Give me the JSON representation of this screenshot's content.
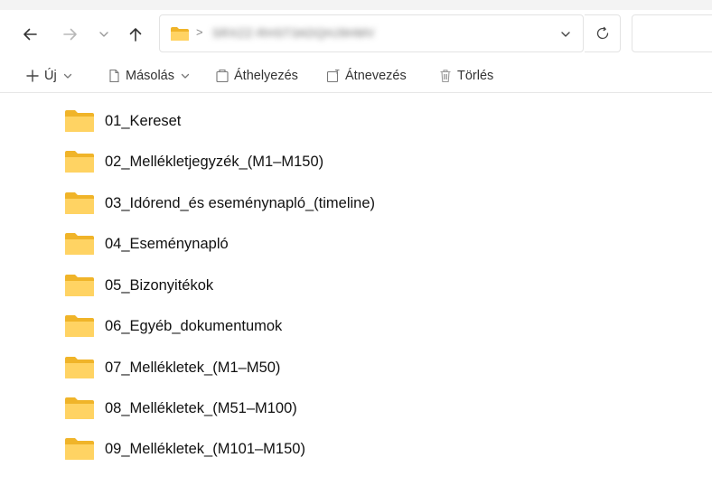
{
  "address_bar": {
    "separator": ">",
    "path_blurred": "SRXZZ-RHST3ADQHJ9HMV"
  },
  "toolbar": {
    "new_label": "Új",
    "copy_label": "Másolás",
    "move_label": "Áthelyezés",
    "rename_label": "Átnevezés",
    "delete_label": "Törlés"
  },
  "folders": [
    {
      "name": "01_Kereset"
    },
    {
      "name": "02_Mellékletjegyzék_(M1–M150)"
    },
    {
      "name": "03_Idórend_és eseménynapló_(timeline)"
    },
    {
      "name": "04_Eseménynapló"
    },
    {
      "name": "05_Bizonyitékok"
    },
    {
      "name": "06_Egyéb_dokumentumok"
    },
    {
      "name": "07_Mellékletek_(M1–M50)"
    },
    {
      "name": "08_Mellékletek_(M51–M100)"
    },
    {
      "name": "09_Mellékletek_(M101–M150)"
    }
  ],
  "colors": {
    "folder_back": "#f0b429",
    "folder_front": "#ffd363",
    "icon_gray": "#555555"
  },
  "icons": {
    "back": "arrow-left-icon",
    "forward": "arrow-right-icon",
    "recent": "chevron-down-icon",
    "up": "arrow-up-icon",
    "refresh": "refresh-icon",
    "new": "plus-icon",
    "copy": "copy-icon",
    "move": "move-icon",
    "rename": "rename-icon",
    "delete": "trash-icon",
    "folder": "folder-icon"
  }
}
